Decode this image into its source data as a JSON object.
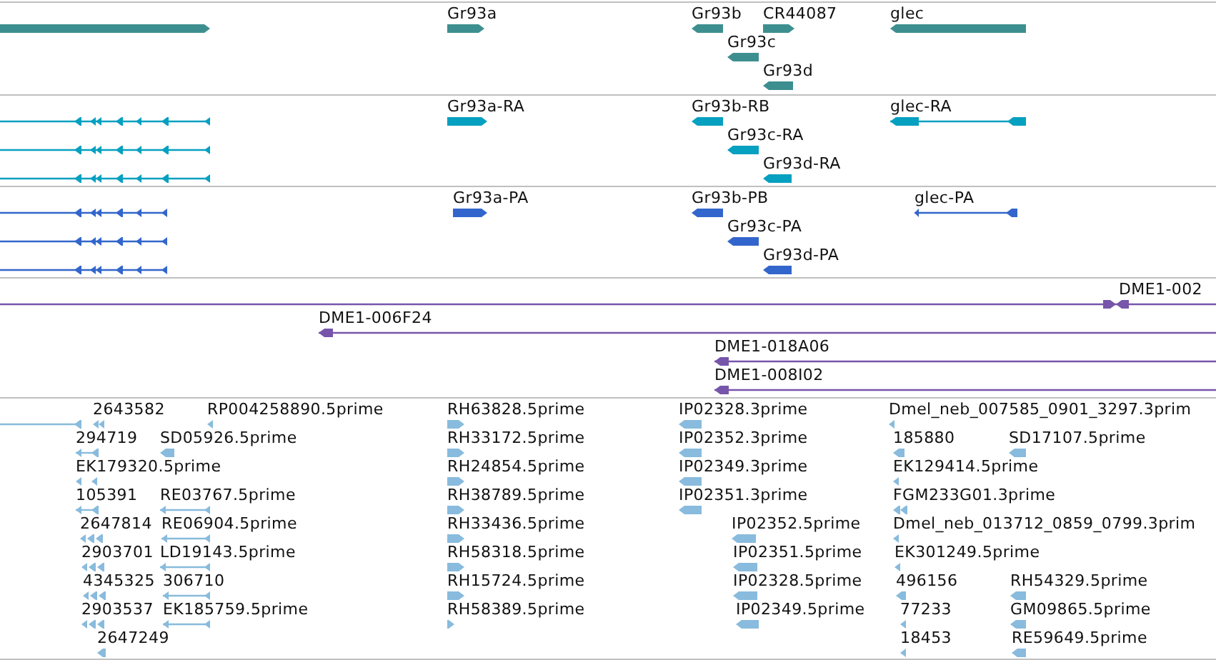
{
  "tracks": [
    {
      "color": "#3d8f8f",
      "lanes": [
        {
          "features": [
            {
              "reverse": false
            },
            {
              "label": "Gr93a",
              "reverse": false
            },
            {
              "label": "Gr93b",
              "reverse": true
            },
            {
              "label": "CR44087",
              "reverse": false
            },
            {
              "label": "glec",
              "reverse": true
            }
          ]
        },
        {
          "features": [
            {
              "label": "Gr93c",
              "reverse": true
            }
          ]
        },
        {
          "features": [
            {
              "label": "Gr93d",
              "reverse": true
            }
          ]
        }
      ]
    },
    {
      "color": "#06a0c0",
      "lanes": [
        {
          "features": [
            {
              "reverse": true
            },
            {
              "label": "Gr93a-RA",
              "reverse": false
            },
            {
              "label": "Gr93b-RB",
              "reverse": true
            },
            {
              "label": "glec-RA",
              "reverse": true
            }
          ]
        },
        {
          "features": [
            {
              "reverse": true
            },
            {
              "label": "Gr93c-RA",
              "reverse": true
            }
          ]
        },
        {
          "features": [
            {
              "reverse": true
            },
            {
              "label": "Gr93d-RA",
              "reverse": true
            }
          ]
        }
      ]
    },
    {
      "color": "#3366cc",
      "lanes": [
        {
          "features": [
            {
              "reverse": true
            },
            {
              "label": "Gr93a-PA",
              "reverse": false
            },
            {
              "label": "Gr93b-PB",
              "reverse": true
            },
            {
              "label": "glec-PA",
              "reverse": true
            }
          ]
        },
        {
          "features": [
            {
              "reverse": true
            },
            {
              "label": "Gr93c-PA",
              "reverse": true
            }
          ]
        },
        {
          "features": [
            {
              "reverse": true
            },
            {
              "label": "Gr93d-PA",
              "reverse": true
            }
          ]
        }
      ]
    },
    {
      "color": "#7755aa",
      "lanes": [
        {
          "features": [
            {
              "reverse": false
            },
            {
              "label": "DME1-002",
              "reverse": true
            }
          ]
        },
        {
          "features": [
            {
              "label": "DME1-006F24",
              "reverse": true
            }
          ]
        },
        {
          "features": [
            {
              "label": "DME1-018A06",
              "reverse": true
            }
          ]
        },
        {
          "features": [
            {
              "label": "DME1-008I02",
              "reverse": true
            }
          ]
        }
      ]
    },
    {
      "color": "#88bbdd",
      "lanes": [
        {
          "features": [
            {
              "reverse": true
            },
            {
              "label": "2643582",
              "reverse": true
            },
            {
              "label": "RP004258890.5prime",
              "reverse": true
            },
            {
              "label": "RH63828.5prime",
              "reverse": false
            },
            {
              "label": "IP02328.3prime",
              "reverse": true
            },
            {
              "label": "Dmel_neb_007585_0901_3297.3prim",
              "reverse": true
            }
          ]
        },
        {
          "features": [
            {
              "label": "294719",
              "reverse": true
            },
            {
              "label": "SD05926.5prime",
              "reverse": true
            },
            {
              "label": "RH33172.5prime",
              "reverse": false
            },
            {
              "label": "IP02352.3prime",
              "reverse": true
            },
            {
              "label": "185880",
              "reverse": true
            },
            {
              "label": "SD17107.5prime",
              "reverse": true
            }
          ]
        },
        {
          "features": [
            {
              "label": "EK179320.5prime",
              "reverse": true
            },
            {
              "label": "RH24854.5prime",
              "reverse": false
            },
            {
              "label": "IP02349.3prime",
              "reverse": true
            },
            {
              "label": "EK129414.5prime",
              "reverse": true
            }
          ]
        },
        {
          "features": [
            {
              "label": "105391",
              "reverse": true
            },
            {
              "label": "RE03767.5prime",
              "reverse": true
            },
            {
              "label": "RH38789.5prime",
              "reverse": false
            },
            {
              "label": "IP02351.3prime",
              "reverse": true
            },
            {
              "label": "FGM233G01.3prime",
              "reverse": true
            }
          ]
        },
        {
          "features": [
            {
              "label": "2647814",
              "reverse": true
            },
            {
              "label": "RE06904.5prime",
              "reverse": true
            },
            {
              "label": "RH33436.5prime",
              "reverse": false
            },
            {
              "label": "IP02352.5prime",
              "reverse": true
            },
            {
              "label": "Dmel_neb_013712_0859_0799.3prim",
              "reverse": true
            }
          ]
        },
        {
          "features": [
            {
              "label": "2903701",
              "reverse": true
            },
            {
              "label": "LD19143.5prime",
              "reverse": true
            },
            {
              "label": "RH58318.5prime",
              "reverse": false
            },
            {
              "label": "IP02351.5prime",
              "reverse": true
            },
            {
              "label": "EK301249.5prime",
              "reverse": true
            }
          ]
        },
        {
          "features": [
            {
              "label": "4345325",
              "reverse": true
            },
            {
              "label": "306710",
              "reverse": true
            },
            {
              "label": "RH15724.5prime",
              "reverse": false
            },
            {
              "label": "IP02328.5prime",
              "reverse": true
            },
            {
              "label": "496156",
              "reverse": true
            },
            {
              "label": "RH54329.5prime",
              "reverse": true
            }
          ]
        },
        {
          "features": [
            {
              "label": "2903537",
              "reverse": true
            },
            {
              "label": "EK185759.5prime",
              "reverse": true
            },
            {
              "label": "RH58389.5prime",
              "reverse": false
            },
            {
              "label": "IP02349.5prime",
              "reverse": true
            },
            {
              "label": "77233",
              "reverse": true
            },
            {
              "label": "GM09865.5prime",
              "reverse": true
            }
          ]
        },
        {
          "features": [
            {
              "label": "2647249",
              "reverse": true
            },
            {
              "label": "18453",
              "reverse": true
            },
            {
              "label": "RE59649.5prime",
              "reverse": true
            }
          ]
        }
      ]
    }
  ]
}
